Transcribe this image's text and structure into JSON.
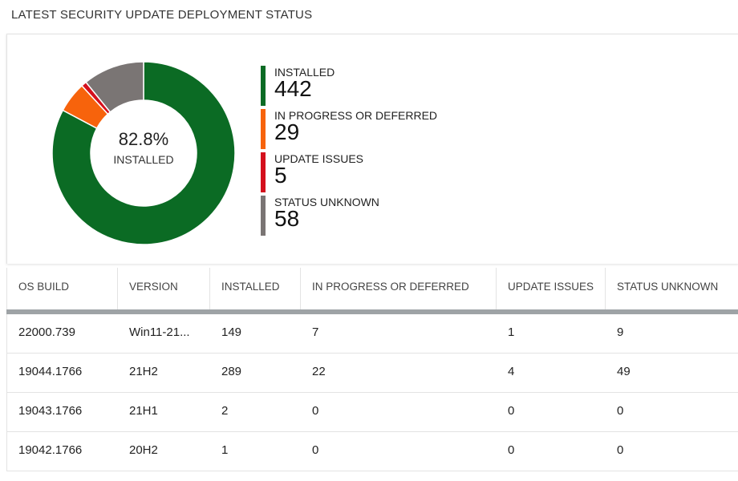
{
  "title": "LATEST SECURITY UPDATE DEPLOYMENT STATUS",
  "donut": {
    "center_percent": "82.8%",
    "center_label": "INSTALLED"
  },
  "chart_data": {
    "type": "pie",
    "title": "",
    "slices": [
      {
        "label": "INSTALLED",
        "value": 442,
        "color": "#0b6b24"
      },
      {
        "label": "IN PROGRESS OR DEFERRED",
        "value": 29,
        "color": "#f7630c"
      },
      {
        "label": "UPDATE ISSUES",
        "value": 5,
        "color": "#d4101d"
      },
      {
        "label": "STATUS UNKNOWN",
        "value": 58,
        "color": "#7a7574"
      }
    ]
  },
  "legend": [
    {
      "label": "INSTALLED",
      "value": "442",
      "color": "#0b6b24"
    },
    {
      "label": "IN PROGRESS OR DEFERRED",
      "value": "29",
      "color": "#f7630c"
    },
    {
      "label": "UPDATE ISSUES",
      "value": "5",
      "color": "#d4101d"
    },
    {
      "label": "STATUS UNKNOWN",
      "value": "58",
      "color": "#7a7574"
    }
  ],
  "table": {
    "headers": [
      "OS BUILD",
      "VERSION",
      "INSTALLED",
      "IN PROGRESS OR DEFERRED",
      "UPDATE ISSUES",
      "STATUS UNKNOWN"
    ],
    "rows": [
      [
        "22000.739",
        "Win11-21...",
        "149",
        "7",
        "1",
        "9"
      ],
      [
        "19044.1766",
        "21H2",
        "289",
        "22",
        "4",
        "49"
      ],
      [
        "19043.1766",
        "21H1",
        "2",
        "0",
        "0",
        "0"
      ],
      [
        "19042.1766",
        "20H2",
        "1",
        "0",
        "0",
        "0"
      ]
    ]
  }
}
